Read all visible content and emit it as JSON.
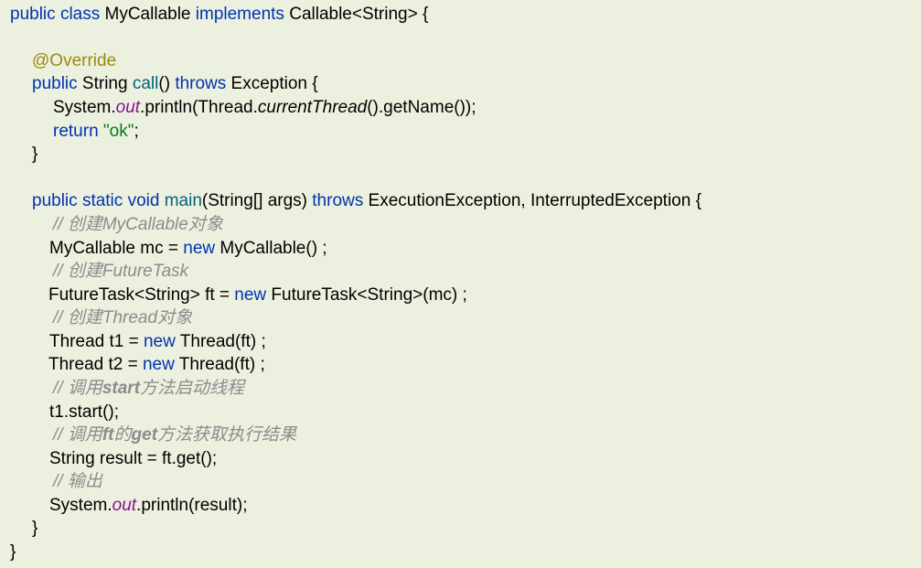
{
  "code": {
    "line_1": {
      "t1": "public",
      "t2": " ",
      "t3": "class",
      "t4": " MyCallable ",
      "t5": "implements",
      "t6": " Callable<String> {"
    },
    "line_3": {
      "t1": "@Override"
    },
    "line_4": {
      "t1": "public",
      "t2": " String ",
      "t3": "call",
      "t4": "() ",
      "t5": "throws",
      "t6": " Exception {"
    },
    "line_5": {
      "t1": "System.",
      "t2": "out",
      "t3": ".println(Thread.",
      "t4": "currentThread",
      "t5": "().getName());"
    },
    "line_6": {
      "t1": "return",
      "t2": " ",
      "t3": "\"ok\"",
      "t4": ";"
    },
    "line_7": {
      "t1": "}"
    },
    "line_9": {
      "t1": "public",
      "t2": " ",
      "t3": "static",
      "t4": " ",
      "t5": "void",
      "t6": " ",
      "t7": "main",
      "t8": "(String[] args) ",
      "t9": "throws",
      "t10": " ExecutionException, InterruptedException {"
    },
    "line_10": {
      "t1": "// 创建MyCallable对象"
    },
    "line_11": {
      "t1": "MyCallable mc = ",
      "t2": "new",
      "t3": " MyCallable() ;"
    },
    "line_12": {
      "t1": "// 创建FutureTask"
    },
    "line_13": {
      "t1": "FutureTask<String> ft = ",
      "t2": "new",
      "t3": " FutureTask<String>(mc) ;"
    },
    "line_14": {
      "t1": "// 创建Thread对象"
    },
    "line_15": {
      "t1": "Thread t1 = ",
      "t2": "new",
      "t3": " Thread(ft) ;"
    },
    "line_16": {
      "t1": "Thread t2 = ",
      "t2": "new",
      "t3": " Thread(ft) ;"
    },
    "line_17": {
      "t1": "// 调用",
      "t2": "start",
      "t3": "方法启动线程"
    },
    "line_18": {
      "t1": "t1.start();"
    },
    "line_19": {
      "t1": "// 调用",
      "t2": "ft",
      "t3": "的",
      "t4": "get",
      "t5": "方法获取执行结果"
    },
    "line_20": {
      "t1": "String result = ft.get();"
    },
    "line_21": {
      "t1": "// 输出"
    },
    "line_22": {
      "t1": "System.",
      "t2": "out",
      "t3": ".println(result);"
    },
    "line_23": {
      "t1": "}"
    },
    "line_24": {
      "t1": "}"
    }
  }
}
